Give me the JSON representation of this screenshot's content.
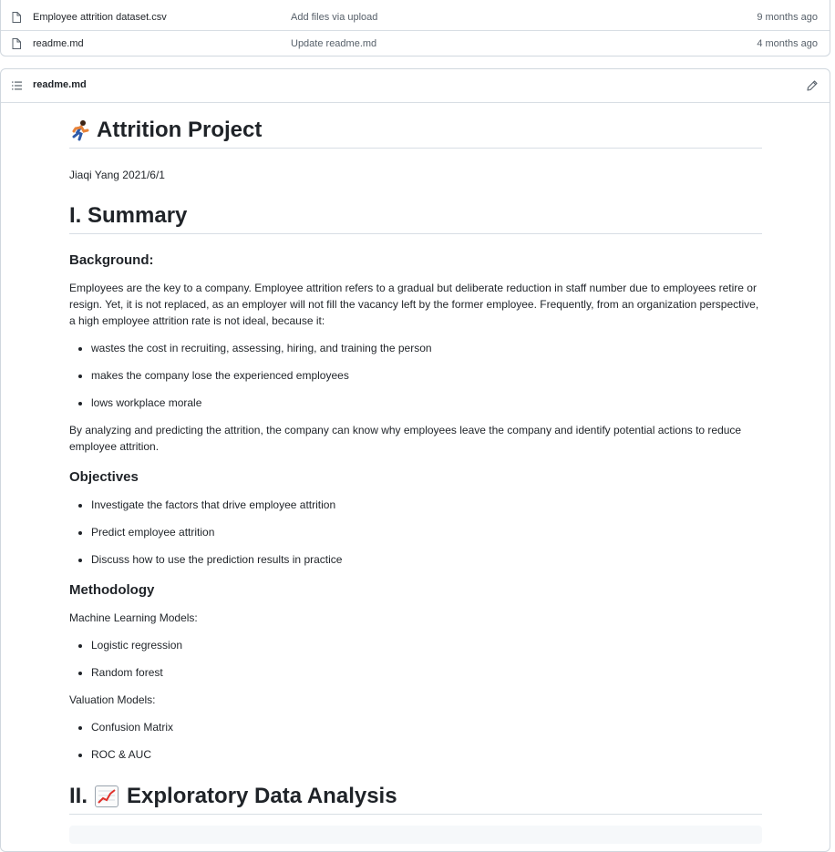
{
  "files": [
    {
      "name": "Employee attrition dataset.csv",
      "commit": "Add files via upload",
      "time": "9 months ago"
    },
    {
      "name": "readme.md",
      "commit": "Update readme.md",
      "time": "4 months ago"
    }
  ],
  "readme": {
    "filename": "readme.md",
    "title": "Attrition Project",
    "title_emoji": "running-person-icon",
    "byline": "Jiaqi Yang 2021/6/1",
    "summary_heading": "I. Summary",
    "background_heading": "Background:",
    "background_para": "Employees are the key to a company. Employee attrition refers to a gradual but deliberate reduction in staff number due to employees retire or resign. Yet, it is not replaced, as an employer will not fill the vacancy left by the former employee. Frequently, from an organization perspective, a high employee attrition rate is not ideal, because it:",
    "background_bullets": [
      "wastes the cost in recruiting, assessing, hiring, and training the person",
      "makes the company lose the experienced employees",
      "lows workplace morale"
    ],
    "analysis_para": "By analyzing and predicting the attrition, the company can know why employees leave the company and identify potential actions to reduce employee attrition.",
    "objectives_heading": "Objectives",
    "objectives_bullets": [
      "Investigate the factors that drive employee attrition",
      "Predict employee attrition",
      "Discuss how to use the prediction results in practice"
    ],
    "methodology_heading": "Methodology",
    "ml_models_label": "Machine Learning Models:",
    "ml_models": [
      "Logistic regression",
      "Random forest"
    ],
    "valuation_label": "Valuation Models:",
    "valuation_models": [
      "Confusion Matrix",
      "ROC & AUC"
    ],
    "eda_heading_prefix": "II.",
    "eda_heading_emoji": "chart-increasing-icon",
    "eda_heading_text": "Exploratory Data Analysis"
  },
  "colors": {
    "border": "#d0d7de",
    "muted": "#57606a",
    "text": "#1f2328"
  }
}
